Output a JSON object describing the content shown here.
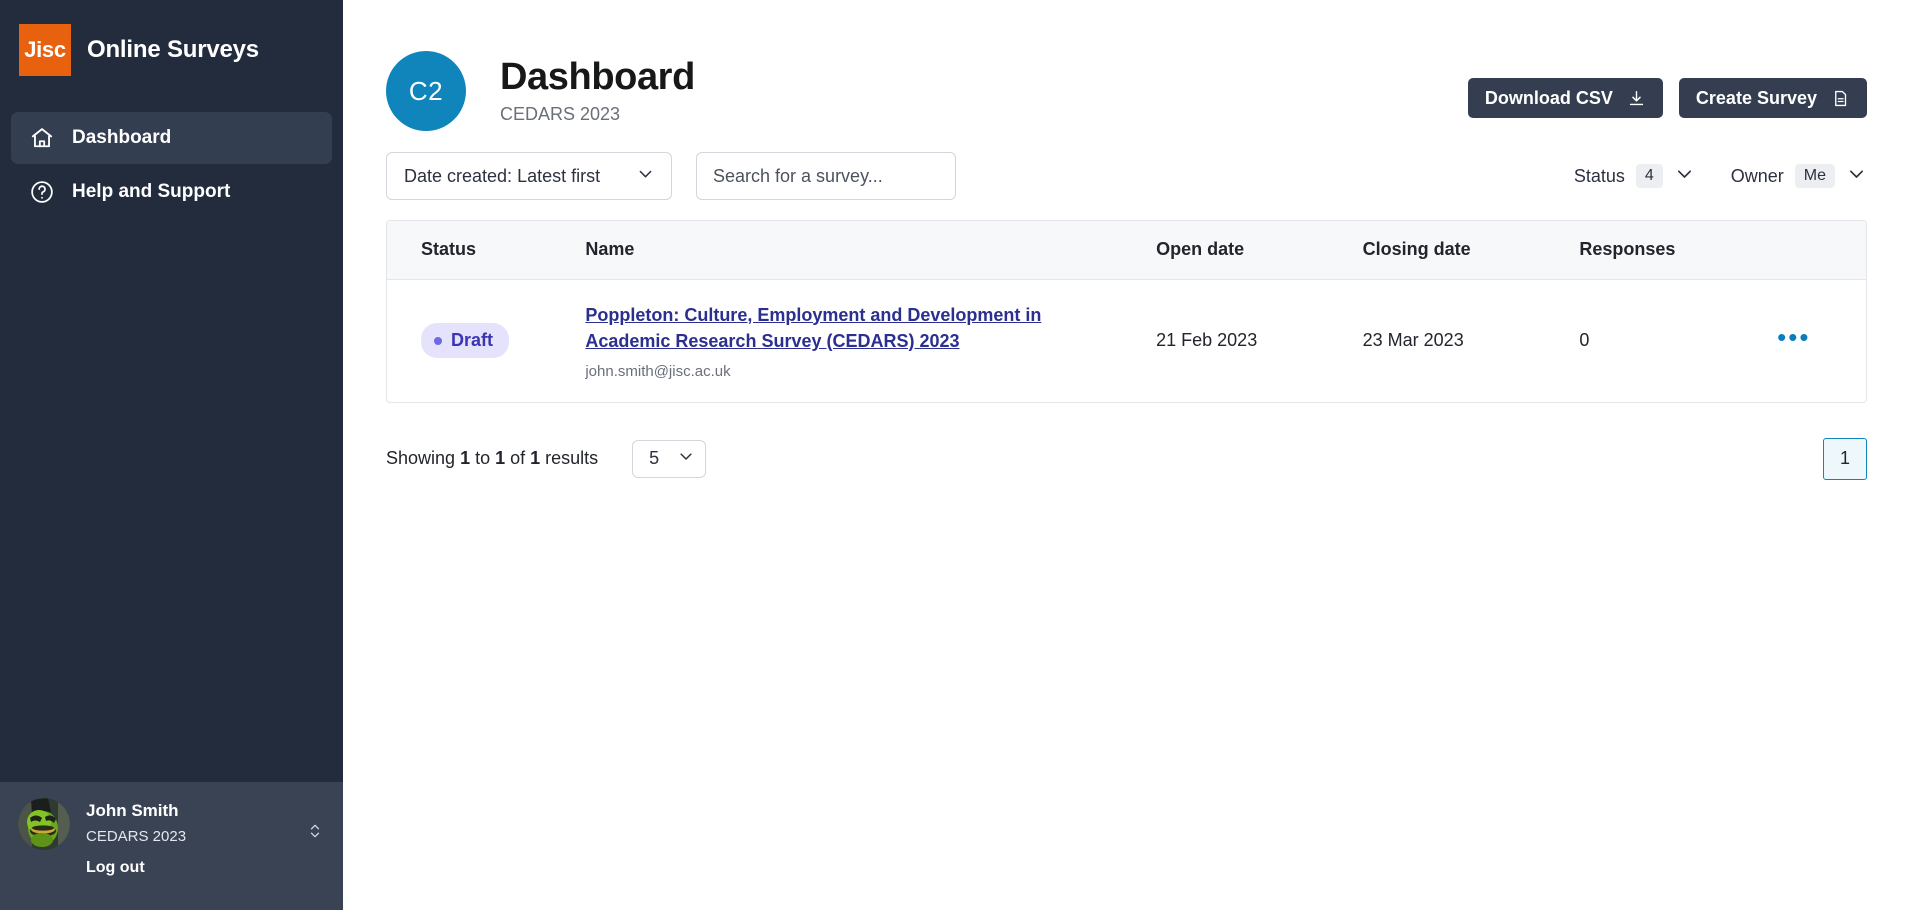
{
  "brand": {
    "logo_text": "Jisc",
    "title": "Online Surveys",
    "logo_color": "#e8610e"
  },
  "sidebar": {
    "items": [
      {
        "label": "Dashboard",
        "icon": "home-icon",
        "active": true
      },
      {
        "label": "Help and Support",
        "icon": "question-circle-icon",
        "active": false
      }
    ],
    "user": {
      "name": "John Smith",
      "organisation": "CEDARS 2023",
      "logout_label": "Log out",
      "avatar": "user-avatar"
    }
  },
  "header": {
    "avatar_initials": "C2",
    "avatar_color": "#0f85bb",
    "title": "Dashboard",
    "subtitle": "CEDARS 2023",
    "actions": [
      {
        "label": "Download CSV",
        "icon": "download-icon"
      },
      {
        "label": "Create Survey",
        "icon": "document-icon"
      }
    ]
  },
  "filters": {
    "sort": {
      "label": "Date created: Latest first",
      "icon": "chevron-down-icon"
    },
    "search": {
      "value": "",
      "placeholder": "Search for a survey..."
    },
    "status": {
      "label": "Status",
      "count": "4",
      "icon": "chevron-down-icon"
    },
    "owner": {
      "label": "Owner",
      "count": "Me",
      "icon": "chevron-down-icon"
    }
  },
  "table": {
    "columns": [
      "Status",
      "Name",
      "Open date",
      "Closing date",
      "Responses"
    ],
    "rows": [
      {
        "status": "Draft",
        "name": "Poppleton: Culture, Employment and Development in Academic Research Survey (CEDARS) 2023",
        "owner_email": "john.smith@jisc.ac.uk",
        "open_date": "21 Feb 2023",
        "closing_date": "23 Mar 2023",
        "responses": "0",
        "menu_icon": "ellipsis-icon",
        "status_color": "#3b34b5",
        "status_bg": "#e4e3fb"
      }
    ]
  },
  "pagination": {
    "showing_prefix": "Showing ",
    "from": "1",
    "to_word": " to ",
    "to": "1",
    "of_word": " of ",
    "total": "1",
    "results_word": " results",
    "page_size": "5",
    "pages": [
      "1"
    ],
    "current_page": "1"
  }
}
